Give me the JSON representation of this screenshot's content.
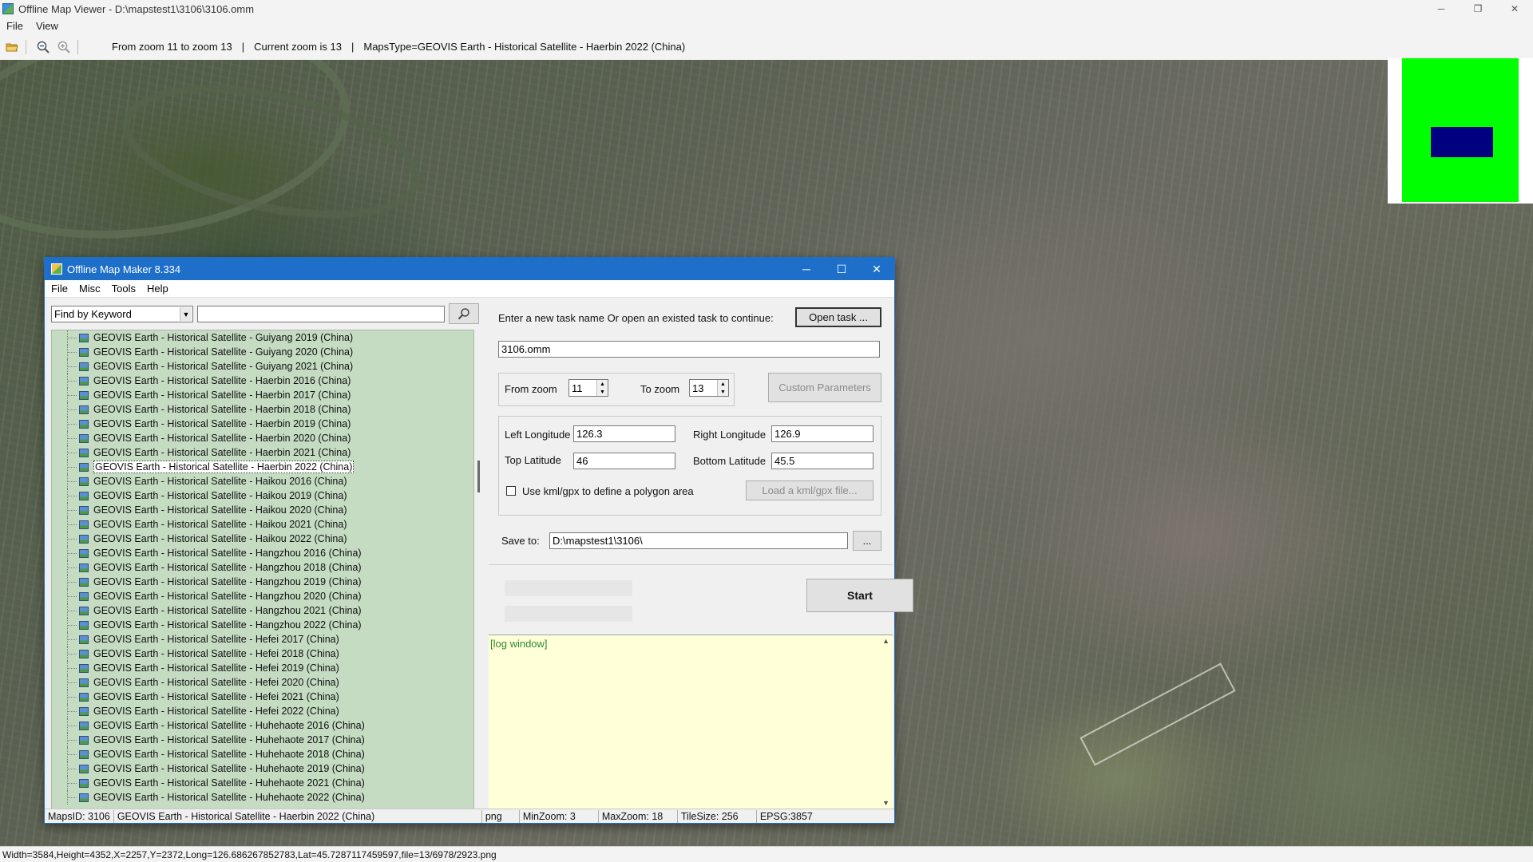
{
  "window": {
    "title": "Offline Map Viewer - D:\\mapstest1\\3106\\3106.omm",
    "minimize": "─",
    "restore": "❐",
    "close": "✕"
  },
  "menu": {
    "file": "File",
    "view": "View"
  },
  "toolbar": {
    "zoom_range": "From zoom 11 to zoom 13",
    "current_zoom": "Current zoom is 13",
    "maps_type": "MapsType=GEOVIS Earth - Historical Satellite - Haerbin 2022 (China)",
    "separator": "|"
  },
  "status": {
    "text": "Width=3584,Height=4352,X=2257,Y=2372,Long=126.686267852783,Lat=45.7287117459597,file=13/6978/2923.png"
  },
  "minimap": {
    "background": "#00ff00",
    "viewport": "#000080"
  },
  "dialog": {
    "title": "Offline Map Maker 8.334",
    "minimize": "─",
    "maximize": "☐",
    "close": "✕",
    "menu": {
      "file": "File",
      "misc": "Misc",
      "tools": "Tools",
      "help": "Help"
    },
    "find_by": "Find by Keyword",
    "search_value": "",
    "maps": [
      "GEOVIS Earth - Historical Satellite - Guiyang 2019 (China)",
      "GEOVIS Earth - Historical Satellite - Guiyang 2020 (China)",
      "GEOVIS Earth - Historical Satellite - Guiyang 2021 (China)",
      "GEOVIS Earth - Historical Satellite - Haerbin 2016 (China)",
      "GEOVIS Earth - Historical Satellite - Haerbin 2017 (China)",
      "GEOVIS Earth - Historical Satellite - Haerbin 2018 (China)",
      "GEOVIS Earth - Historical Satellite - Haerbin 2019 (China)",
      "GEOVIS Earth - Historical Satellite - Haerbin 2020 (China)",
      "GEOVIS Earth - Historical Satellite - Haerbin 2021 (China)",
      "GEOVIS Earth - Historical Satellite - Haerbin 2022 (China)",
      "GEOVIS Earth - Historical Satellite - Haikou 2016 (China)",
      "GEOVIS Earth - Historical Satellite - Haikou 2019 (China)",
      "GEOVIS Earth - Historical Satellite - Haikou 2020 (China)",
      "GEOVIS Earth - Historical Satellite - Haikou 2021 (China)",
      "GEOVIS Earth - Historical Satellite - Haikou 2022 (China)",
      "GEOVIS Earth - Historical Satellite - Hangzhou 2016 (China)",
      "GEOVIS Earth - Historical Satellite - Hangzhou 2018 (China)",
      "GEOVIS Earth - Historical Satellite - Hangzhou 2019 (China)",
      "GEOVIS Earth - Historical Satellite - Hangzhou 2020 (China)",
      "GEOVIS Earth - Historical Satellite - Hangzhou 2021 (China)",
      "GEOVIS Earth - Historical Satellite - Hangzhou 2022 (China)",
      "GEOVIS Earth - Historical Satellite - Hefei 2017 (China)",
      "GEOVIS Earth - Historical Satellite - Hefei 2018 (China)",
      "GEOVIS Earth - Historical Satellite - Hefei 2019 (China)",
      "GEOVIS Earth - Historical Satellite - Hefei 2020 (China)",
      "GEOVIS Earth - Historical Satellite - Hefei 2021 (China)",
      "GEOVIS Earth - Historical Satellite - Hefei 2022 (China)",
      "GEOVIS Earth - Historical Satellite - Huhehaote 2016 (China)",
      "GEOVIS Earth - Historical Satellite - Huhehaote 2017 (China)",
      "GEOVIS Earth - Historical Satellite - Huhehaote 2018 (China)",
      "GEOVIS Earth - Historical Satellite - Huhehaote 2019 (China)",
      "GEOVIS Earth - Historical Satellite - Huhehaote 2021 (China)",
      "GEOVIS Earth - Historical Satellite - Huhehaote 2022 (China)"
    ],
    "selected_map": "GEOVIS Earth - Historical Satellite - Haerbin 2022 (China)",
    "task_prompt": "Enter a new task name Or open an existed task to continue:",
    "open_task": "Open task ...",
    "task_name": "3106.omm",
    "from_zoom_label": "From zoom",
    "from_zoom": "11",
    "to_zoom_label": "To zoom",
    "to_zoom": "13",
    "custom_params": "Custom Parameters",
    "left_lon_label": "Left Longitude",
    "left_lon": "126.3",
    "right_lon_label": "Right Longitude",
    "right_lon": "126.9",
    "top_lat_label": "Top Latitude",
    "top_lat": "46",
    "bottom_lat_label": "Bottom Latitude",
    "bottom_lat": "45.5",
    "use_kml": "Use kml/gpx to define a polygon area",
    "use_kml_checked": false,
    "load_kml": "Load a kml/gpx file...",
    "save_to_label": "Save to:",
    "save_to": "D:\\mapstest1\\3106\\",
    "browse": "...",
    "start": "Start",
    "log": "[log window]",
    "statusbar": {
      "maps_id": "MapsID: 3106",
      "maps_name": "GEOVIS Earth - Historical Satellite - Haerbin 2022 (China)",
      "format": "png",
      "min_zoom": "MinZoom: 3",
      "max_zoom": "MaxZoom: 18",
      "tile_size": "TileSize: 256",
      "epsg": "EPSG:3857"
    }
  }
}
